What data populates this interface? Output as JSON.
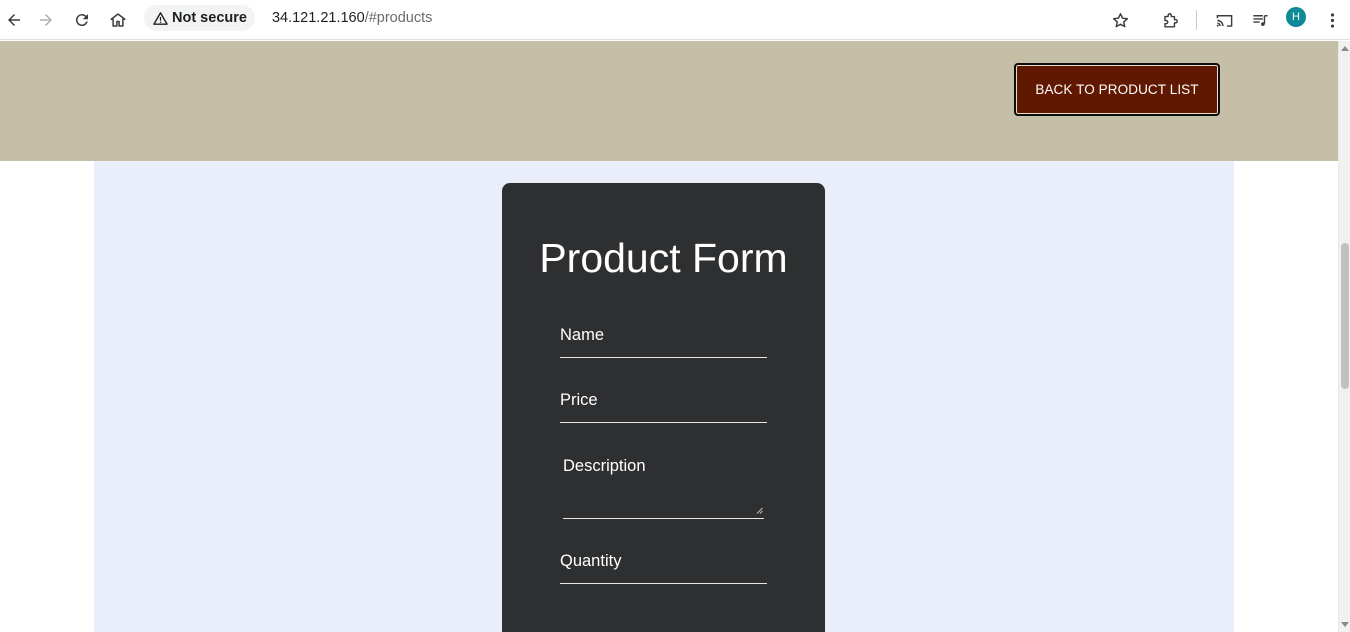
{
  "browser": {
    "security_label": "Not secure",
    "url_host": "34.121.21.160",
    "url_path": "/#products",
    "profile_initial": "H"
  },
  "page": {
    "back_button_label": "BACK TO PRODUCT LIST",
    "form": {
      "title": "Product Form",
      "fields": {
        "name": "Name",
        "price": "Price",
        "description": "Description",
        "quantity": "Quantity"
      }
    }
  },
  "colors": {
    "header_band": "#c5bfa8",
    "back_button": "#611800",
    "content_bg": "#eaeefb",
    "form_card": "#2e2f31",
    "profile": "#0e8a98"
  }
}
